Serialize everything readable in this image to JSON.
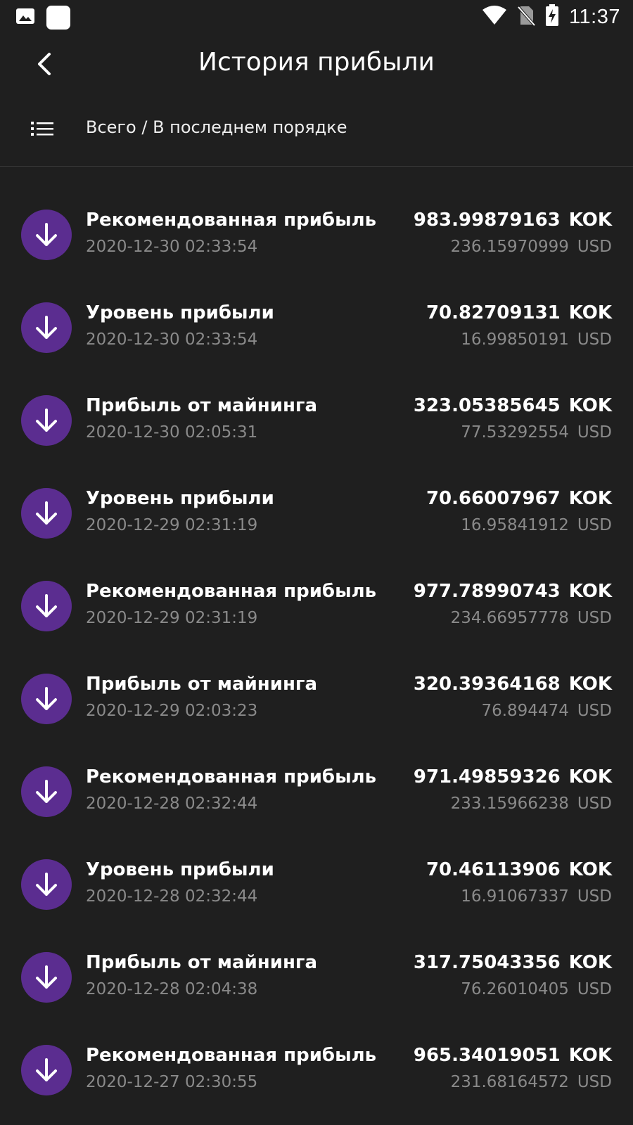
{
  "status_bar": {
    "time": "11:37",
    "icons": [
      "gallery-icon",
      "app-icon",
      "wifi-icon",
      "no-sim-icon",
      "battery-charging-icon"
    ]
  },
  "header": {
    "title": "История прибыли",
    "back_icon": "chevron-left-icon"
  },
  "filter": {
    "icon": "list-icon",
    "label": "Всего / В последнем порядке"
  },
  "colors": {
    "background": "#1f1f1f",
    "accent": "#5b2d90",
    "secondary_text": "#8a8a8a"
  },
  "transactions": [
    {
      "title": "Рекомендованная прибыль",
      "date": "2020-12-30 02:33:54",
      "amount": "983.99879163",
      "currency": "KOK",
      "usd": "236.15970999",
      "usd_label": "USD"
    },
    {
      "title": "Уровень прибыли",
      "date": "2020-12-30 02:33:54",
      "amount": "70.82709131",
      "currency": "KOK",
      "usd": "16.99850191",
      "usd_label": "USD"
    },
    {
      "title": "Прибыль от майнинга",
      "date": "2020-12-30 02:05:31",
      "amount": "323.05385645",
      "currency": "KOK",
      "usd": "77.53292554",
      "usd_label": "USD"
    },
    {
      "title": "Уровень прибыли",
      "date": "2020-12-29 02:31:19",
      "amount": "70.66007967",
      "currency": "KOK",
      "usd": "16.95841912",
      "usd_label": "USD"
    },
    {
      "title": "Рекомендованная прибыль",
      "date": "2020-12-29 02:31:19",
      "amount": "977.78990743",
      "currency": "KOK",
      "usd": "234.66957778",
      "usd_label": "USD"
    },
    {
      "title": "Прибыль от майнинга",
      "date": "2020-12-29 02:03:23",
      "amount": "320.39364168",
      "currency": "KOK",
      "usd": "76.894474",
      "usd_label": "USD"
    },
    {
      "title": "Рекомендованная прибыль",
      "date": "2020-12-28 02:32:44",
      "amount": "971.49859326",
      "currency": "KOK",
      "usd": "233.15966238",
      "usd_label": "USD"
    },
    {
      "title": "Уровень прибыли",
      "date": "2020-12-28 02:32:44",
      "amount": "70.46113906",
      "currency": "KOK",
      "usd": "16.91067337",
      "usd_label": "USD"
    },
    {
      "title": "Прибыль от майнинга",
      "date": "2020-12-28 02:04:38",
      "amount": "317.75043356",
      "currency": "KOK",
      "usd": "76.26010405",
      "usd_label": "USD"
    },
    {
      "title": "Рекомендованная прибыль",
      "date": "2020-12-27 02:30:55",
      "amount": "965.34019051",
      "currency": "KOK",
      "usd": "231.68164572",
      "usd_label": "USD"
    }
  ]
}
